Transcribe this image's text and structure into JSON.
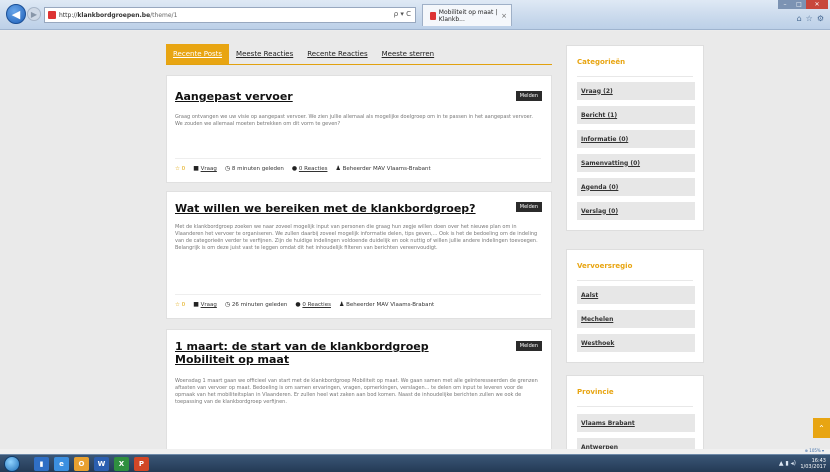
{
  "browser": {
    "url_domain": "klankbordgroepen.be",
    "url_prefix": "http://",
    "url_rest": "/theme/1",
    "address_tools": "ρ ▾ C",
    "tab_title": "Mobiliteit op maat | Klankb...",
    "tab_close": "×"
  },
  "tabs": [
    {
      "label": "Recente Posts",
      "active": true
    },
    {
      "label": "Meeste Reacties",
      "active": false
    },
    {
      "label": "Recente Reacties",
      "active": false
    },
    {
      "label": "Meeste sterren",
      "active": false
    }
  ],
  "posts": [
    {
      "title": "Aangepast vervoer",
      "melden": "Melden",
      "excerpt": "Graag ontvangen we uw visie op aangepast vervoer. We zien jullie allemaal als mogelijke doelgroep om in te passen in het aangepast vervoer. We zouden we allemaal moeten betrekken om dit vorm te geven?",
      "stars": "☆ 0",
      "category": "Vraag",
      "time": "8 minuten geleden",
      "reactions": "0 Reacties",
      "author": "Beheerder MAV Vlaams-Brabant"
    },
    {
      "title": "Wat willen we bereiken met de klankbordgroep?",
      "melden": "Melden",
      "excerpt": "Met de klankbordgroep zoeken we naar zoveel mogelijk input van personen die graag hun zegje willen doen over het nieuwe plan om in Vlaanderen het vervoer te organiseren. We zullen daarbij zoveel mogelijk informatie delen, tips geven,... Ook is het de bedoeling om de indeling van de categorieën verder te verfijnen. Zijn de huidige indelingen voldoende duidelijk en ook nuttig of willen jullie andere indelingen toevoegen. Belangrijk is om deze juist vast te leggen omdat dit het inhoudelijk filteren van berichten vereenvoudigt.",
      "stars": "☆ 0",
      "category": "Vraag",
      "time": "26 minuten geleden",
      "reactions": "0 Reacties",
      "author": "Beheerder MAV Vlaams-Brabant"
    },
    {
      "title": "1 maart: de start van de klankbordgroep Mobiliteit op maat",
      "melden": "Melden",
      "excerpt": "Woensdag 1 maart gaan we officieel van start met de klankbordgroep Mobiliteit op maat. We gaan samen met alle geïnteresseerden de grenzen aftasten van vervoer op maat. Bedoeling is om samen ervaringen, vragen, opmerkingen, verslagen... te delen om input te leveren voor de opmaak van het mobiliteitsplan in Vlaanderen. Er zullen heel wat zaken aan bod komen. Naast de inhoudelijke berichten zullen we ook de toepassing van de klankbordgroep verfijnen."
    }
  ],
  "sidebar": {
    "categories": {
      "title": "Categorieën",
      "items": [
        "Vraag (2)",
        "Bericht (1)",
        "Informatie (0)",
        "Samenvatting (0)",
        "Agenda (0)",
        "Verslag (0)"
      ]
    },
    "vervoersregio": {
      "title": "Vervoersregio",
      "items": [
        "Aalst",
        "Mechelen",
        "Westhoek"
      ]
    },
    "provincie": {
      "title": "Provincie",
      "items": [
        "Vlaams Brabant",
        "Antwerpen"
      ]
    }
  },
  "status": {
    "zoom": "⊕ 105% ▾"
  },
  "taskbar": {
    "time": "16:43",
    "date": "1/03/2017"
  },
  "colors": {
    "accent": "#e8a512",
    "melden_bg": "#2b2b2b"
  }
}
